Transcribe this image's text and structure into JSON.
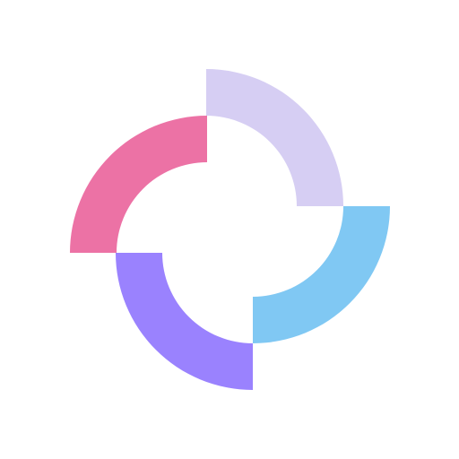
{
  "logo": {
    "name": "four-quarter-ring-logo",
    "colors": {
      "top_right_quarter": "#D6CEF3",
      "left_quarter": "#EC72A5",
      "right_quarter": "#80C8F3",
      "bottom_quarter": "#9A82FE",
      "background": "#FFFFFF"
    }
  }
}
